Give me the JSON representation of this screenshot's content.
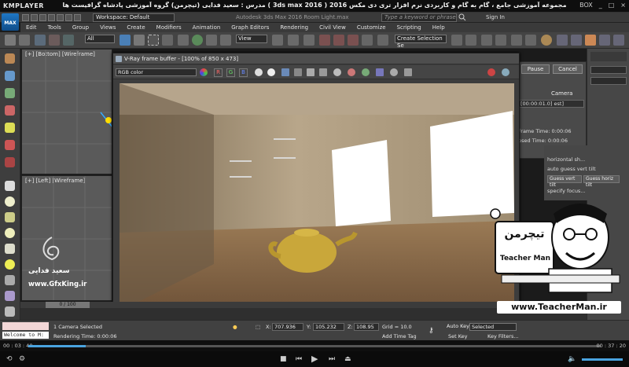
{
  "player": {
    "logo": "KMPLAYER",
    "title": "مجموعه آموزشی جامع ، گام به گام و کاربردی نرم افزار تری دی مکس 2016 ( 3ds max 2016 ) مدرس : سعید فدایی (تیچرمن) گروه آموزشی پادشاه گرافیست ها",
    "controls": [
      "BOX",
      "_",
      "□",
      "×"
    ],
    "time_current": "00 : 03 : 40",
    "time_total": "00 : 37 : 20",
    "progress": 0.1
  },
  "max": {
    "logo": "MAX",
    "workspace": "Workspace: Default",
    "app_title": "Autodesk 3ds Max 2016    Room Light.max",
    "search_placeholder": "Type a keyword or phrase",
    "signin": "Sign In",
    "menu": [
      "Edit",
      "Tools",
      "Group",
      "Views",
      "Create",
      "Modifiers",
      "Animation",
      "Graph Editors",
      "Rendering",
      "Civil View",
      "Customize",
      "Scripting",
      "Help"
    ],
    "toolbar": {
      "filter": "All",
      "view": "View",
      "create_selection": "Create Selection Se"
    }
  },
  "viewports": {
    "top_label": "[+] [Bottom] [Wireframe]",
    "left_label": "[+] [Left] [Wireframe]"
  },
  "vfb": {
    "title": "V-Ray frame buffer - [100% of 850 x 473]",
    "channel": "RGB color",
    "channels": [
      "R",
      "G",
      "B"
    ]
  },
  "render_dialog": {
    "pause": "Pause",
    "cancel": "Cancel",
    "camera": "Camera",
    "progress": "[00:00:01.0] est]",
    "frame_time_label": "Frame Time:",
    "frame_time": "0:00:06",
    "elapsed_label": "psed Time:",
    "elapsed": "0:00:06"
  },
  "camera_panel": {
    "horizontal": "horizontal sh...",
    "auto_guess": "auto guess vert tilt",
    "guess_vert": "Guess vert tilt",
    "guess_horiz": "Guess horiz tilt",
    "specify_focus": "specify focus..."
  },
  "timeline": {
    "frame": "0 / 100"
  },
  "status": {
    "selected": "1 Camera Selected",
    "rendering_time": "Rendering Time: 0:00:06",
    "welcome": "Welcome to M:",
    "x_label": "X:",
    "x": "707.936",
    "y_label": "Y:",
    "y": "105.232",
    "z_label": "Z:",
    "z": "108.95",
    "grid": "Grid = 10.0",
    "add_time_tag": "Add Time Tag",
    "auto_key": "Auto Key",
    "set_key": "Set Key",
    "selected_option": "Selected",
    "key_filters": "Key Filters..."
  },
  "watermark": {
    "url": "www.TeacherMan.ir",
    "teacher_fa": "تیچرمن",
    "teacher_en": "Teacher Man",
    "gfx_fa": "سعید فدایی",
    "gfx_url": "www.GfxKing.ir"
  }
}
